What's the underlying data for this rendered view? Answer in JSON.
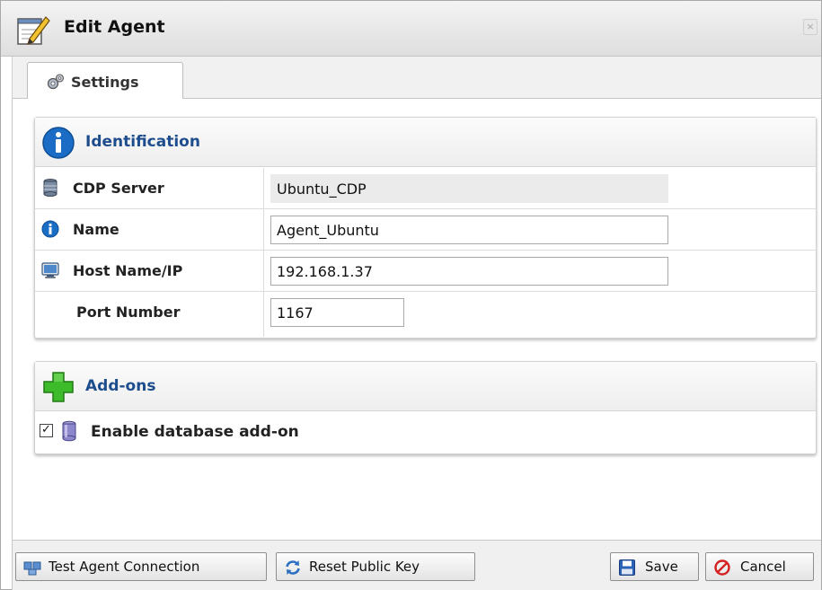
{
  "window": {
    "title": "Edit Agent",
    "close_label": "×"
  },
  "tabs": [
    {
      "label": "Settings",
      "icon": "gears-icon"
    }
  ],
  "identification": {
    "title": "Identification",
    "rows": [
      {
        "label": "CDP Server",
        "value": "Ubuntu_CDP",
        "icon": "database-icon",
        "readonly": true
      },
      {
        "label": "Name",
        "value": "Agent_Ubuntu",
        "icon": "info-icon"
      },
      {
        "label": "Host Name/IP",
        "value": "192.168.1.37",
        "icon": "host-icon"
      },
      {
        "label": "Port Number",
        "value": "1167"
      }
    ]
  },
  "addons": {
    "title": "Add-ons",
    "items": [
      {
        "label": "Enable database add-on",
        "checked": true,
        "check_mark": "✓"
      }
    ]
  },
  "footer": {
    "test_connection_label": "Test Agent Connection",
    "reset_key_label": "Reset Public Key",
    "save_label": "Save",
    "cancel_label": "Cancel"
  },
  "colors": {
    "accent_blue": "#1d4d8c",
    "addon_green": "#3dbb2a",
    "cancel_red": "#d42020"
  }
}
